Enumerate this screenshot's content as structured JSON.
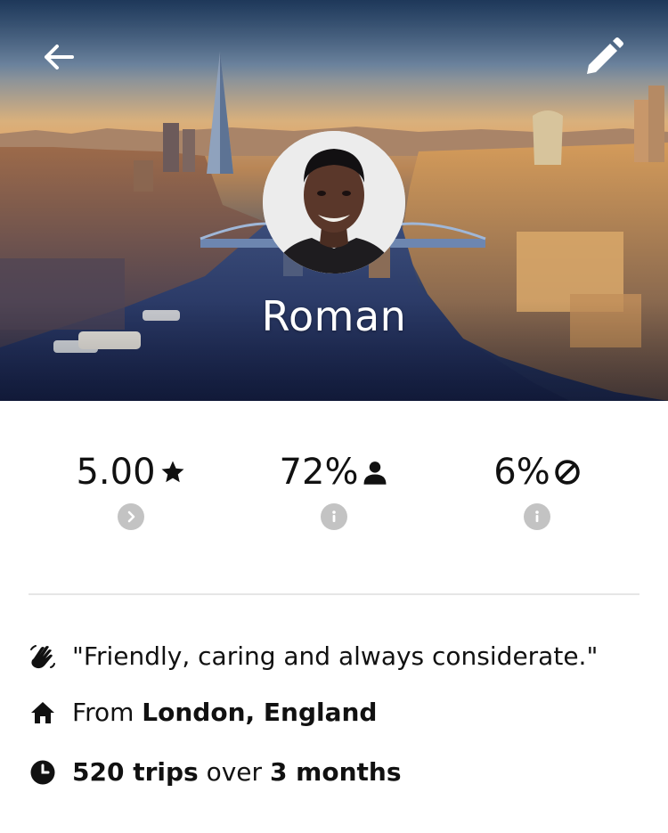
{
  "header": {
    "back_icon": "arrow-left-icon",
    "edit_icon": "pencil-icon",
    "name": "Roman"
  },
  "stats": [
    {
      "value": "5.00",
      "icon": "star-icon",
      "action_icon": "chevron-right-icon"
    },
    {
      "value": "72%",
      "icon": "person-icon",
      "action_icon": "info-icon"
    },
    {
      "value": "6%",
      "icon": "prohibited-icon",
      "action_icon": "info-icon"
    }
  ],
  "info": {
    "quote": "\"Friendly, caring and always considerate.\"",
    "from_prefix": "From ",
    "from_location": "London, England",
    "trips_count": "520 trips",
    "trips_mid": " over ",
    "trips_duration": "3 months"
  },
  "colors": {
    "text": "#111111",
    "stat_action_bg": "#c3c3c3",
    "divider": "#e6e6e6",
    "header_text": "#ffffff"
  }
}
